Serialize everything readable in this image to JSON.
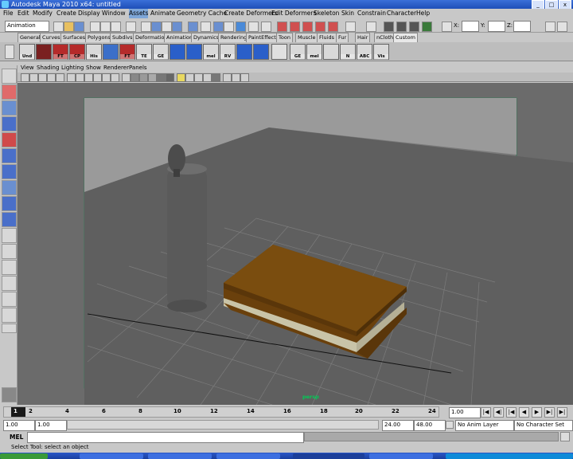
{
  "window": {
    "title": "Autodesk Maya 2010 x64: untitled",
    "min_label": "_",
    "max_label": "□",
    "close_label": "x"
  },
  "menu": [
    "File",
    "Edit",
    "Modify",
    "Create",
    "Display",
    "Window",
    "Assets",
    "Animate",
    "Geometry Cache",
    "Create Deformers",
    "Edit Deformers",
    "Skeleton",
    "Skin",
    "Constrain",
    "Character",
    "Help"
  ],
  "status": {
    "mode": "Animation",
    "x_label": "X:",
    "y_label": "Y:",
    "z_label": "Z:"
  },
  "shelf_tabs": [
    "General",
    "Curves",
    "Surfaces",
    "Polygons",
    "Subdivs",
    "Deformation",
    "Animation",
    "Dynamics",
    "Rendering",
    "PaintEffects",
    "Toon",
    "Muscle",
    "Fluids",
    "Fur",
    "Hair",
    "nCloth",
    "Custom"
  ],
  "active_shelf_tab": "Custom",
  "shelf_icons": [
    {
      "name": "undo-icon",
      "label": "Und",
      "color": "#d9d9d9"
    },
    {
      "name": "shelf-script-icon",
      "label": "",
      "color": "#7a2020"
    },
    {
      "name": "ft-icon",
      "label": "FT",
      "color": "#b52a2a"
    },
    {
      "name": "cp-icon",
      "label": "CP",
      "color": "#b52a2a"
    },
    {
      "name": "his-icon",
      "label": "His",
      "color": "#d9d9d9"
    },
    {
      "name": "character-icon",
      "label": "",
      "color": "#3b6fc9"
    },
    {
      "name": "ft2-icon",
      "label": "FT",
      "color": "#b52a2a"
    },
    {
      "name": "te-icon",
      "label": "TE",
      "color": "#d9d9d9"
    },
    {
      "name": "ge-icon",
      "label": "GE",
      "color": "#d9d9d9"
    },
    {
      "name": "blue-cube-icon",
      "label": "",
      "color": "#2a5fc9"
    },
    {
      "name": "blue-cube2-icon",
      "label": "",
      "color": "#2a5fc9"
    },
    {
      "name": "mel-icon",
      "label": "mel",
      "color": "#d9d9d9"
    },
    {
      "name": "rv-icon",
      "label": "RV",
      "color": "#d9d9d9"
    },
    {
      "name": "render-icon",
      "label": "",
      "color": "#2a5fc9"
    },
    {
      "name": "render2-icon",
      "label": "",
      "color": "#2a5fc9"
    },
    {
      "name": "blank-icon",
      "label": "",
      "color": "#e0e0e0"
    },
    {
      "name": "ge2-icon",
      "label": "GE",
      "color": "#d9d9d9"
    },
    {
      "name": "mel2-icon",
      "label": "mel",
      "color": "#d9d9d9"
    },
    {
      "name": "curve-icon",
      "label": "",
      "color": "#d9d9d9"
    },
    {
      "name": "n-icon",
      "label": "N",
      "color": "#d9d9d9"
    },
    {
      "name": "abc-icon",
      "label": "ABC",
      "color": "#d9d9d9"
    },
    {
      "name": "vis-icon",
      "label": "Vis",
      "color": "#d9d9d9"
    }
  ],
  "panel_menu": [
    "View",
    "Shading",
    "Lighting",
    "Show",
    "Renderer",
    "Panels"
  ],
  "camera_label": "persp",
  "timeline": {
    "ticks": [
      "1",
      "2",
      "4",
      "6",
      "8",
      "10",
      "12",
      "14",
      "16",
      "18",
      "20",
      "22",
      "24"
    ],
    "current_frame": "1.00"
  },
  "range": {
    "start": "1.00",
    "inner_start": "1.00",
    "inner_end": "24.00",
    "end": "48.00",
    "anim_layer": "No Anim Layer",
    "character_set": "No Character Set"
  },
  "command": {
    "label": "MEL"
  },
  "help_text": "Select Tool: select an object",
  "colors": {
    "viewport_bg": "#6b6b6b",
    "book_cover": "#7a4d0f",
    "pages": "#c9c4a8",
    "candle": "#5f5f5f"
  }
}
